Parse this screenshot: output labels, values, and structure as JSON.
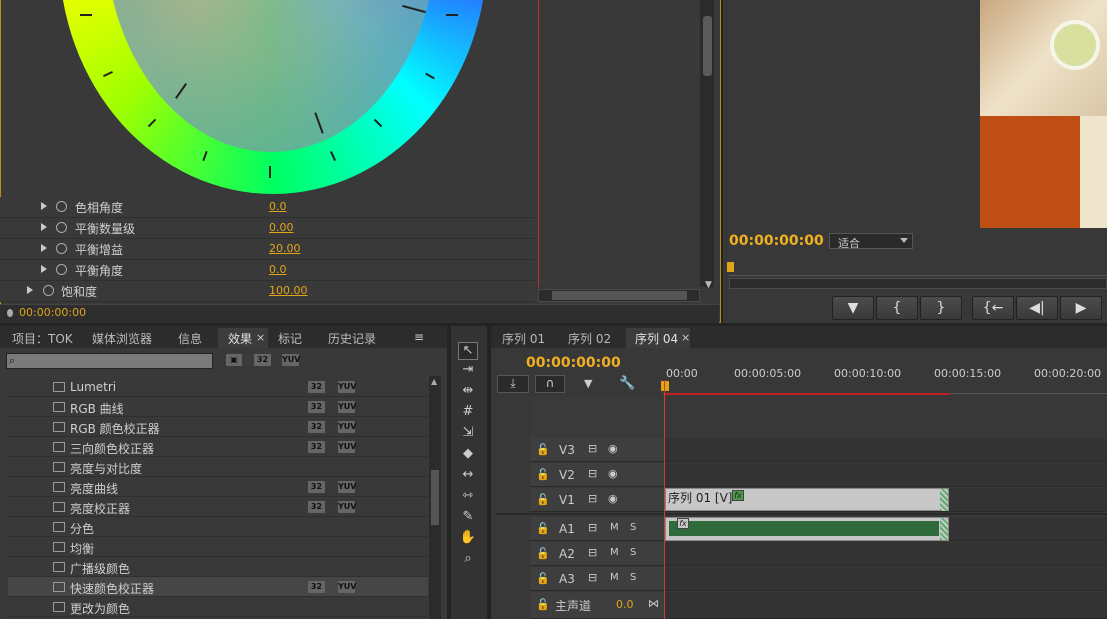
{
  "effect_controls": {
    "params": [
      {
        "label": "色相角度",
        "value": "0.0"
      },
      {
        "label": "平衡数量级",
        "value": "0.00"
      },
      {
        "label": "平衡增益",
        "value": "20.00"
      },
      {
        "label": "平衡角度",
        "value": "0.0"
      },
      {
        "label": "饱和度",
        "value": "100.00"
      }
    ],
    "timecode": "00:00:00:00"
  },
  "program_monitor": {
    "timecode": "00:00:00:00",
    "fit_label": "适合",
    "buttons": [
      "marker",
      "mark-in",
      "mark-out",
      "go-to-in",
      "step-back",
      "play"
    ]
  },
  "project_panel": {
    "tabs": [
      "项目：TOK",
      "媒体浏览器",
      "信息",
      "效果",
      "标记",
      "历史记录"
    ],
    "active_tab": "效果",
    "search_placeholder": "",
    "filter_badges": [
      "32",
      "YUV"
    ],
    "effects": [
      {
        "name": "Lumetri",
        "badges": [
          "32",
          "YUV"
        ]
      },
      {
        "name": "RGB 曲线",
        "badges": [
          "32",
          "YUV"
        ]
      },
      {
        "name": "RGB 颜色校正器",
        "badges": [
          "32",
          "YUV"
        ]
      },
      {
        "name": "三向颜色校正器",
        "badges": [
          "32",
          "YUV"
        ]
      },
      {
        "name": "亮度与对比度",
        "badges": []
      },
      {
        "name": "亮度曲线",
        "badges": [
          "32",
          "YUV"
        ]
      },
      {
        "name": "亮度校正器",
        "badges": [
          "32",
          "YUV"
        ]
      },
      {
        "name": "分色",
        "badges": []
      },
      {
        "name": "均衡",
        "badges": []
      },
      {
        "name": "广播级颜色",
        "badges": []
      },
      {
        "name": "快速颜色校正器",
        "badges": [
          "32",
          "YUV"
        ]
      },
      {
        "name": "更改为颜色",
        "badges": []
      }
    ]
  },
  "timeline": {
    "tabs": [
      "序列 01",
      "序列 02",
      "序列 04"
    ],
    "active_tab": "序列 04",
    "timecode": "00:00:00:00",
    "ruler": [
      "00:00",
      "00:00:05:00",
      "00:00:10:00",
      "00:00:15:00",
      "00:00:20:00"
    ],
    "video_tracks": [
      "V3",
      "V2",
      "V1"
    ],
    "audio_tracks": [
      "A1",
      "A2",
      "A3"
    ],
    "master_label": "主声道",
    "master_value": "0.0",
    "mute": "M",
    "solo": "S",
    "clip_v1_label": "序列 01 [V]",
    "fx_label": "fx"
  },
  "colors": {
    "accent": "#e0a419",
    "panel_border": "#c08a18",
    "playhead": "#d04020"
  }
}
